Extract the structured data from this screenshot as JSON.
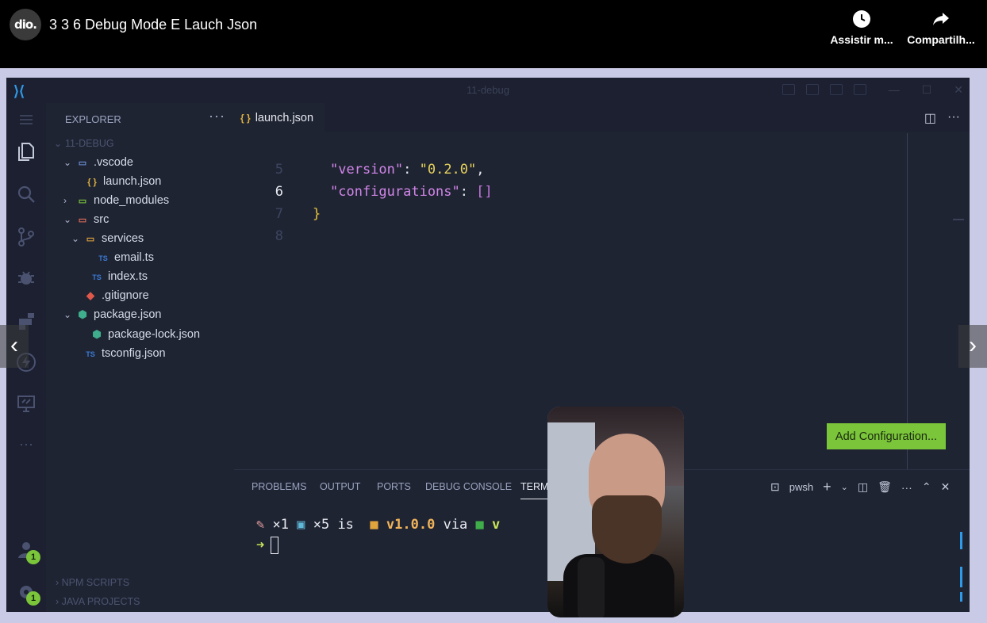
{
  "video": {
    "title": "3 3 6 Debug Mode E Lauch Json",
    "logo_text": "dio.",
    "actions": [
      {
        "label": "Assistir m...",
        "icon": "clock-icon"
      },
      {
        "label": "Compartilh...",
        "icon": "share-icon"
      }
    ]
  },
  "window": {
    "title": "11-debug"
  },
  "explorer": {
    "header": "EXPLORER",
    "more": "···",
    "root": "11-DEBUG",
    "items": [
      {
        "label": ".vscode",
        "type": "folder",
        "open": true
      },
      {
        "label": "launch.json",
        "type": "json",
        "icon_text": "{ }"
      },
      {
        "label": "node_modules",
        "type": "folder",
        "open": false
      },
      {
        "label": "src",
        "type": "folder",
        "open": true
      },
      {
        "label": "services",
        "type": "folder",
        "open": true
      },
      {
        "label": "email.ts",
        "type": "ts",
        "icon_text": "TS"
      },
      {
        "label": "index.ts",
        "type": "ts",
        "icon_text": "TS"
      },
      {
        "label": ".gitignore",
        "type": "git",
        "icon_text": "◆"
      },
      {
        "label": "package.json",
        "type": "node",
        "open": true,
        "icon_text": "⬢"
      },
      {
        "label": "package-lock.json",
        "type": "node",
        "icon_text": "⬢"
      },
      {
        "label": "tsconfig.json",
        "type": "tsconfig",
        "icon_text": "TS"
      }
    ],
    "sections": [
      "NPM SCRIPTS",
      "JAVA PROJECTS"
    ]
  },
  "editor": {
    "tab": {
      "label": "launch.json",
      "icon_text": "{ }"
    },
    "lines": [
      {
        "num": "5",
        "key": "\"version\"",
        "sep": ": ",
        "value": "\"0.2.0\"",
        "end": ","
      },
      {
        "num": "6",
        "key": "\"configurations\"",
        "sep": ": ",
        "value": "[]",
        "end": ""
      },
      {
        "num": "7",
        "brace": "}"
      },
      {
        "num": "8"
      }
    ],
    "add_config_button": "Add Configuration..."
  },
  "panel": {
    "tabs": [
      "PROBLEMS",
      "OUTPUT",
      "PORTS",
      "DEBUG CONSOLE",
      "TERMI"
    ],
    "active_tab": "TERMI",
    "shell": "pwsh",
    "terminal": {
      "line1_a": "×1",
      "line1_b": "×5 is",
      "line1_version": "v1.0.0",
      "line1_via": "via",
      "line1_v": "v",
      "prompt": "➜"
    }
  },
  "badges": {
    "accounts": "1",
    "settings": "1"
  },
  "colors": {
    "accent_green": "#7bc53a",
    "editor_bg": "#1f2433",
    "vscode_blue": "#2f9ae8"
  }
}
